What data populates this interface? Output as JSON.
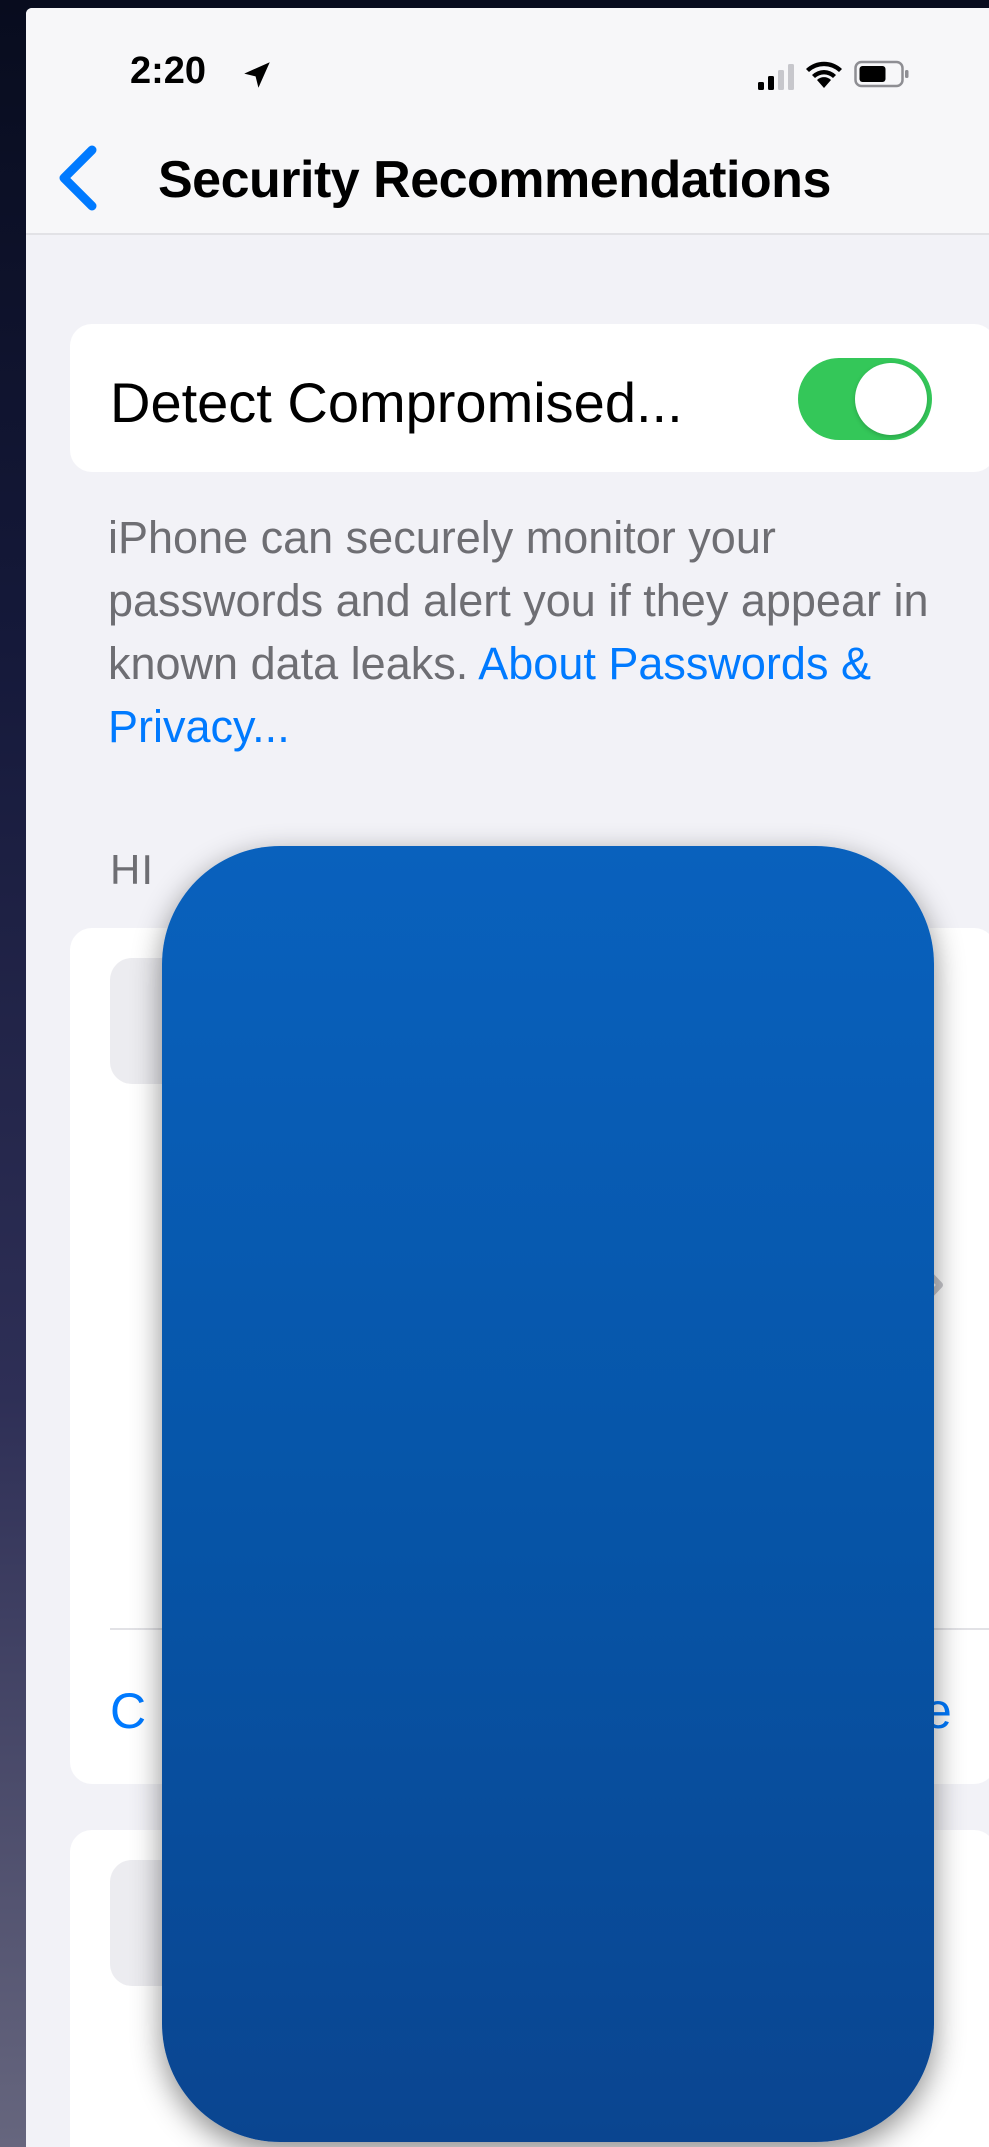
{
  "status_bar": {
    "time": "2:20",
    "icons": [
      "location-arrow-icon",
      "cellular-signal-icon",
      "wifi-icon",
      "battery-icon"
    ]
  },
  "nav": {
    "back_icon": "chevron-left-icon",
    "title": "Security Recommendations"
  },
  "detect_card": {
    "label": "Detect Compromised...",
    "toggle_on": true
  },
  "detect_footer": {
    "text": "iPhone can securely monitor your passwords and alert you if they appear in known data leaks.",
    "link_label": "About Passwords & Privacy..."
  },
  "section": {
    "header_visible_fragment": "HI"
  },
  "rec_card": {
    "action_left_fragment": "C",
    "action_right_fragment": "e",
    "chevron_icon": "chevron-right-icon"
  },
  "overlay": {
    "description": "redaction-overlay"
  },
  "colors": {
    "accent": "#007aff",
    "toggle_on": "#34c759",
    "secondary_text": "#6e6e73",
    "background": "#f2f2f7",
    "overlay": "#0655a8"
  }
}
